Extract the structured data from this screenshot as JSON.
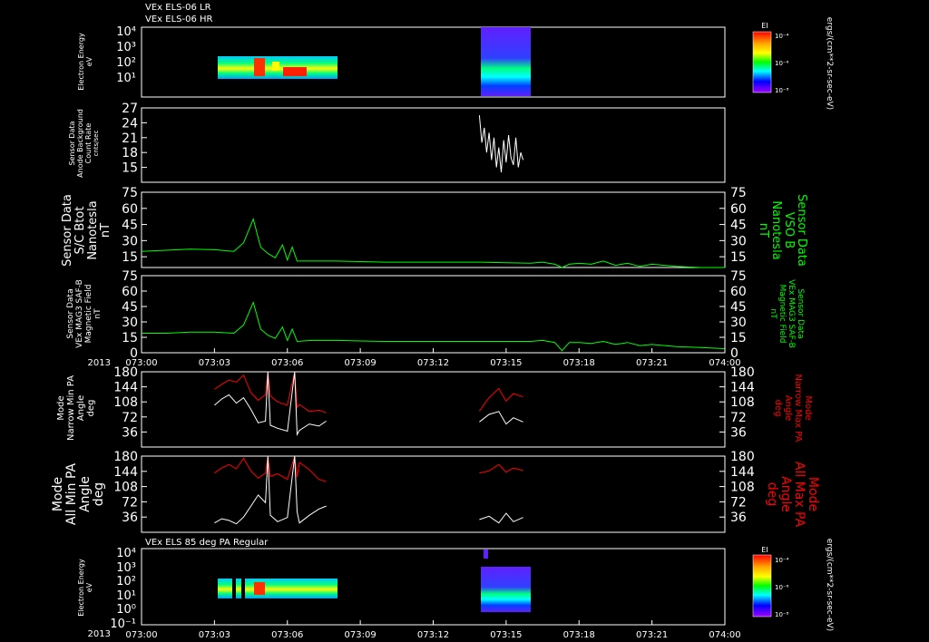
{
  "header": {
    "line1": "VEx ELS-06 LR",
    "line2": "VEx ELS-06 HR",
    "panel7_title": "VEx ELS 85 deg PA Regular"
  },
  "year_label": "2013",
  "x_ticks": [
    "073:00",
    "073:03",
    "073:06",
    "073:09",
    "073:12",
    "073:15",
    "073:18",
    "073:21",
    "074:00"
  ],
  "colors": {
    "background": "#000000",
    "axis": "#ffffff",
    "mag": "#00ff00",
    "pa_max": "#ff0000",
    "pa_min": "#ffffff"
  },
  "colorbars": [
    {
      "title": "EI",
      "ticks": [
        "10⁻⁴",
        "10⁻⁶",
        "10⁻⁸"
      ]
    },
    {
      "title": "EI",
      "ticks": [
        "10⁻⁴",
        "10⁻⁶",
        "10⁻⁸"
      ]
    }
  ],
  "units_label": "ergs/(cm**2-sr-sec-eV)",
  "chart_data": [
    {
      "type": "heatmap",
      "panel": "p1",
      "ylabel": [
        "Electron Energy",
        "eV"
      ],
      "yscale": "log",
      "yticks": [
        "10⁴",
        "10³",
        "10²",
        "10¹"
      ],
      "coverage": [
        {
          "start": "073:03:00",
          "end": "073:07:40"
        },
        {
          "start": "073:13:50",
          "end": "073:15:50"
        }
      ]
    },
    {
      "type": "line",
      "panel": "p2",
      "ylabel": [
        "Sensor Data",
        "Anode Background",
        "Count Rate",
        "cnts/sec"
      ],
      "ylim": [
        12,
        27
      ],
      "yticks": [
        "27",
        "24",
        "21",
        "18",
        "15"
      ],
      "series": [
        {
          "color": "#ffffff",
          "x_minutes": [
            13.9,
            14.0,
            14.1,
            14.2,
            14.3,
            14.4,
            14.5,
            14.6,
            14.7,
            14.8,
            14.9,
            15.0,
            15.1,
            15.2,
            15.3,
            15.4,
            15.5,
            15.6,
            15.7
          ],
          "values": [
            25.5,
            20,
            23,
            18,
            22,
            16.5,
            21,
            15,
            19,
            14,
            20.5,
            16,
            21.5,
            17,
            15.5,
            21,
            15,
            18,
            16.5
          ]
        }
      ]
    },
    {
      "type": "line",
      "panel": "p3",
      "ylabel": [
        "Sensor Data",
        "S/C Btot",
        "Nanotesla",
        "nT"
      ],
      "ylabel_right": [
        "Sensor Data",
        "VSO B",
        "Nanotesla",
        "nT"
      ],
      "ylim": [
        5,
        75
      ],
      "yticks": [
        "75",
        "60",
        "45",
        "30",
        "15"
      ],
      "series": [
        {
          "color": "#00ff00",
          "x_minutes": [
            0,
            1,
            2,
            3,
            3.8,
            4.2,
            4.6,
            4.9,
            5.2,
            5.5,
            5.8,
            6.0,
            6.2,
            6.4,
            7,
            8,
            9,
            10,
            11,
            12,
            13,
            14,
            15,
            16,
            16.5,
            17,
            17.3,
            17.6,
            18,
            18.5,
            19,
            19.5,
            20,
            20.5,
            21,
            22,
            23,
            24
          ],
          "values": [
            20,
            21,
            22,
            21.5,
            20,
            28,
            50,
            24,
            18,
            14,
            26,
            12,
            24,
            11,
            11,
            11,
            10.5,
            10,
            10,
            10,
            10,
            10,
            9.5,
            9,
            10,
            8,
            1,
            8,
            9,
            8,
            11,
            7,
            9,
            6,
            8,
            6,
            5,
            4
          ]
        }
      ]
    },
    {
      "type": "line",
      "panel": "p4",
      "ylabel": [
        "Sensor Data",
        "VEx MAG3 SAF-B",
        "Magnetic Field",
        "nT"
      ],
      "ylabel_right": [
        "Sensor Data",
        "VEx MAG3 SAF-B",
        "Magnetic Field",
        "nT"
      ],
      "ylim": [
        0,
        75
      ],
      "yticks": [
        "75",
        "60",
        "45",
        "30",
        "15",
        "0"
      ],
      "series": [
        {
          "color": "#00ff00",
          "x_minutes": [
            0,
            1,
            2,
            3,
            3.8,
            4.2,
            4.6,
            4.9,
            5.2,
            5.5,
            5.8,
            6.0,
            6.2,
            6.4,
            7,
            8,
            9,
            10,
            11,
            12,
            13,
            14,
            15,
            16,
            16.5,
            17,
            17.3,
            17.6,
            18,
            18.5,
            19,
            19.5,
            20,
            20.5,
            21,
            22,
            23,
            24
          ],
          "values": [
            19,
            19,
            20,
            20,
            19,
            27,
            49,
            23,
            17,
            14,
            25,
            12,
            23,
            11,
            12,
            12,
            11.5,
            11,
            11,
            11,
            11,
            11,
            11,
            11,
            12,
            10,
            2,
            10,
            10,
            9,
            11,
            8,
            10,
            7,
            8,
            6,
            5,
            4
          ]
        }
      ]
    },
    {
      "type": "line",
      "panel": "p5",
      "ylabel": [
        "Mode",
        "Narrow Min PA",
        "Angle",
        "deg"
      ],
      "ylabel_right": [
        "Mode",
        "Narrow Max PA",
        "Angle",
        "deg"
      ],
      "ylim": [
        0,
        180
      ],
      "yticks": [
        "180",
        "144",
        "108",
        "72",
        "36"
      ],
      "series": [
        {
          "color": "#ff0000",
          "x_minutes": [
            3.0,
            3.3,
            3.6,
            3.9,
            4.2,
            4.5,
            4.8,
            5.1,
            5.2,
            5.3,
            5.6,
            6.0,
            6.3,
            6.4,
            6.5,
            6.9,
            7.3,
            7.6,
            13.9,
            14.3,
            14.7,
            15.0,
            15.3,
            15.7
          ],
          "values": [
            138,
            150,
            160,
            155,
            172,
            130,
            112,
            125,
            180,
            122,
            108,
            100,
            180,
            95,
            102,
            85,
            88,
            82,
            86,
            118,
            140,
            110,
            128,
            120
          ]
        },
        {
          "color": "#ffffff",
          "x_minutes": [
            3.0,
            3.3,
            3.6,
            3.9,
            4.2,
            4.5,
            4.8,
            5.1,
            5.2,
            5.3,
            5.6,
            6.0,
            6.3,
            6.4,
            6.5,
            6.9,
            7.3,
            7.6,
            13.9,
            14.3,
            14.7,
            15.0,
            15.3,
            15.7
          ],
          "values": [
            100,
            115,
            125,
            105,
            118,
            90,
            58,
            62,
            180,
            52,
            45,
            38,
            180,
            30,
            40,
            55,
            50,
            62,
            60,
            78,
            85,
            55,
            70,
            60
          ]
        }
      ]
    },
    {
      "type": "line",
      "panel": "p6",
      "ylabel": [
        "Mode",
        "All Min PA",
        "Angle",
        "deg"
      ],
      "ylabel_right": [
        "Mode",
        "All Max PA",
        "Angle",
        "deg"
      ],
      "ylim": [
        0,
        180
      ],
      "yticks": [
        "180",
        "144",
        "108",
        "72",
        "36"
      ],
      "series": [
        {
          "color": "#ff0000",
          "x_minutes": [
            3.0,
            3.3,
            3.6,
            3.9,
            4.2,
            4.5,
            4.8,
            5.1,
            5.2,
            5.3,
            5.6,
            6.0,
            6.3,
            6.4,
            6.5,
            6.9,
            7.3,
            7.6,
            13.9,
            14.3,
            14.7,
            15.0,
            15.3,
            15.7
          ],
          "values": [
            140,
            152,
            160,
            150,
            175,
            145,
            128,
            140,
            180,
            132,
            138,
            125,
            180,
            130,
            165,
            148,
            125,
            120,
            140,
            145,
            160,
            142,
            152,
            146
          ]
        },
        {
          "color": "#ffffff",
          "x_minutes": [
            3.0,
            3.3,
            3.6,
            3.9,
            4.2,
            4.5,
            4.8,
            5.1,
            5.2,
            5.3,
            5.6,
            6.0,
            6.3,
            6.4,
            6.5,
            6.9,
            7.3,
            7.6,
            13.9,
            14.3,
            14.7,
            15.0,
            15.3,
            15.7
          ],
          "values": [
            22,
            32,
            28,
            20,
            36,
            62,
            88,
            70,
            180,
            40,
            25,
            35,
            180,
            48,
            22,
            40,
            55,
            62,
            30,
            38,
            22,
            45,
            25,
            35
          ]
        }
      ]
    },
    {
      "type": "heatmap",
      "panel": "p7",
      "ylabel": [
        "Electron Energy",
        "eV"
      ],
      "yscale": "log",
      "yticks": [
        "10⁴",
        "10³",
        "10²",
        "10¹",
        "10⁰",
        "10⁻¹"
      ],
      "coverage": [
        {
          "start": "073:03:00",
          "end": "073:07:40"
        },
        {
          "start": "073:13:50",
          "end": "073:15:50"
        }
      ]
    }
  ]
}
